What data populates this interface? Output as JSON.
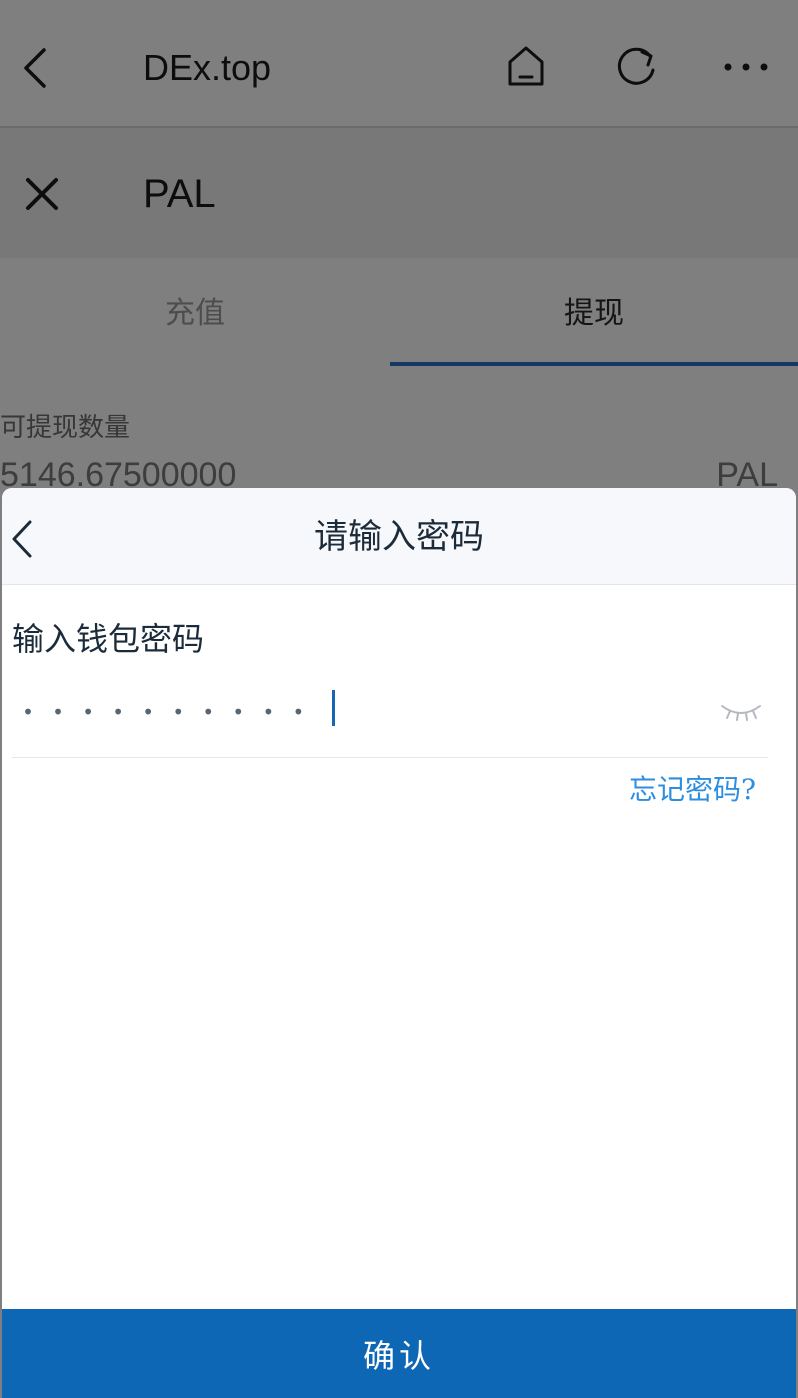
{
  "browser": {
    "title": "DEx.top",
    "icons": [
      "back-arrow-icon",
      "home-icon",
      "refresh-icon",
      "more-icon"
    ]
  },
  "page": {
    "title": "PAL",
    "close_icon": "close-icon"
  },
  "tabs": [
    {
      "label": "充值",
      "active": false
    },
    {
      "label": "提现",
      "active": true
    }
  ],
  "balance": {
    "label": "可提现数量",
    "value": "5146.67500000",
    "unit": "PAL"
  },
  "modal": {
    "title": "请输入密码",
    "back_icon": "back-arrow-icon",
    "field_label": "输入钱包密码",
    "password_value": "••••••••••",
    "eye_icon": "eye-closed-icon",
    "forgot_label": "忘记密码?",
    "confirm_label": "确认"
  },
  "colors": {
    "accent": "#0e67b5",
    "link": "#2d8ee0",
    "tab_underline": "#2f6fc7"
  }
}
